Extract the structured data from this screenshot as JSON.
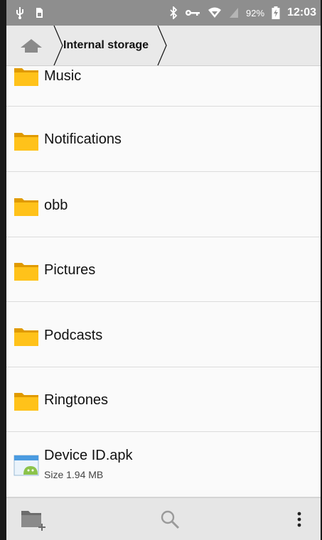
{
  "status_bar": {
    "battery_percent": "92%",
    "time": "12:03",
    "icons": [
      "usb-icon",
      "sim-icon",
      "bluetooth-icon",
      "vpn-key-icon",
      "wifi-icon",
      "no-signal-icon",
      "battery-charging-icon"
    ]
  },
  "breadcrumb": {
    "home_icon": "home-icon",
    "current": "Internal storage"
  },
  "files": [
    {
      "name": "Music",
      "type": "folder"
    },
    {
      "name": "Notifications",
      "type": "folder"
    },
    {
      "name": "obb",
      "type": "folder"
    },
    {
      "name": "Pictures",
      "type": "folder"
    },
    {
      "name": "Podcasts",
      "type": "folder"
    },
    {
      "name": "Ringtones",
      "type": "folder"
    },
    {
      "name": "Device ID.apk",
      "type": "apk",
      "size": "Size 1.94 MB"
    }
  ],
  "bottom_bar": {
    "icons": [
      "new-folder-icon",
      "search-icon",
      "more-options-icon"
    ]
  },
  "colors": {
    "status_bar": "#8e8e8e",
    "breadcrumb_bar": "#e9e9e9",
    "folder": "#f5b400",
    "background": "#fafafa"
  }
}
